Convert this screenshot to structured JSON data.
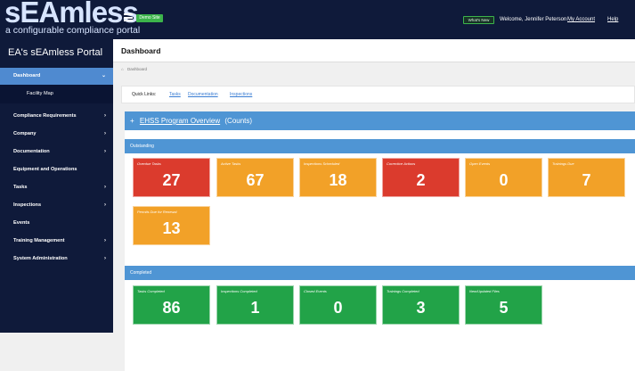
{
  "topbar": {
    "logo_main": "sEAmless",
    "logo_sub": "a configurable compliance portal",
    "demo_badge": "Demo Site",
    "whats_new": "What's New",
    "welcome": "Welcome, Jennifer Peterson",
    "my_account": "My Account",
    "help": "Help"
  },
  "sidebar": {
    "portal_title": "EA's sEAmless Portal",
    "dashboard_label": "Dashboard",
    "sub_item": "Facility Map",
    "items": [
      {
        "label": "Compliance Requirements",
        "has_chevron": true
      },
      {
        "label": "Company",
        "has_chevron": true
      },
      {
        "label": "Documentation",
        "has_chevron": true
      },
      {
        "label": "Equipment and Operations",
        "has_chevron": false
      },
      {
        "label": "Tasks",
        "has_chevron": true
      },
      {
        "label": "Inspections",
        "has_chevron": true
      },
      {
        "label": "Events",
        "has_chevron": false
      },
      {
        "label": "Training Management",
        "has_chevron": true
      },
      {
        "label": "System Administration",
        "has_chevron": true
      }
    ]
  },
  "main": {
    "title": "Dashboard",
    "breadcrumb": "Dashboard",
    "quick_links_label": "Quick Links:",
    "quick_links": [
      "Tasks",
      "Documentation",
      "Inspections"
    ],
    "overview_toggle": "+",
    "overview_title": "EHSS Program Overview",
    "overview_suffix": "(Counts)",
    "outstanding_title": "Outstanding",
    "completed_title": "Completed",
    "outstanding_tiles": [
      {
        "label": "Overdue Tasks",
        "value": "27",
        "color": "#db3b2d"
      },
      {
        "label": "Active Tasks",
        "value": "67",
        "color": "#f2a128"
      },
      {
        "label": "Inspections Scheduled",
        "value": "18",
        "color": "#f2a128"
      },
      {
        "label": "Corrective Actions",
        "value": "2",
        "color": "#db3b2d"
      },
      {
        "label": "Open Events",
        "value": "0",
        "color": "#f2a128"
      },
      {
        "label": "Trainings Due",
        "value": "7",
        "color": "#f2a128"
      },
      {
        "label": "Permits Due for Renewal",
        "value": "13",
        "color": "#f2a128"
      }
    ],
    "completed_tiles": [
      {
        "label": "Tasks Completed",
        "value": "86",
        "color": "#22a348"
      },
      {
        "label": "Inspections Completed",
        "value": "1",
        "color": "#22a348"
      },
      {
        "label": "Closed Events",
        "value": "0",
        "color": "#22a348"
      },
      {
        "label": "Trainings Completed",
        "value": "3",
        "color": "#22a348"
      },
      {
        "label": "New/Updated Files",
        "value": "5",
        "color": "#22a348"
      }
    ]
  },
  "icons": {
    "home": "home-icon",
    "menu": "hamburger-menu-icon",
    "chevron_right": "chevron-right-icon",
    "chevron_down": "chevron-down-icon"
  }
}
